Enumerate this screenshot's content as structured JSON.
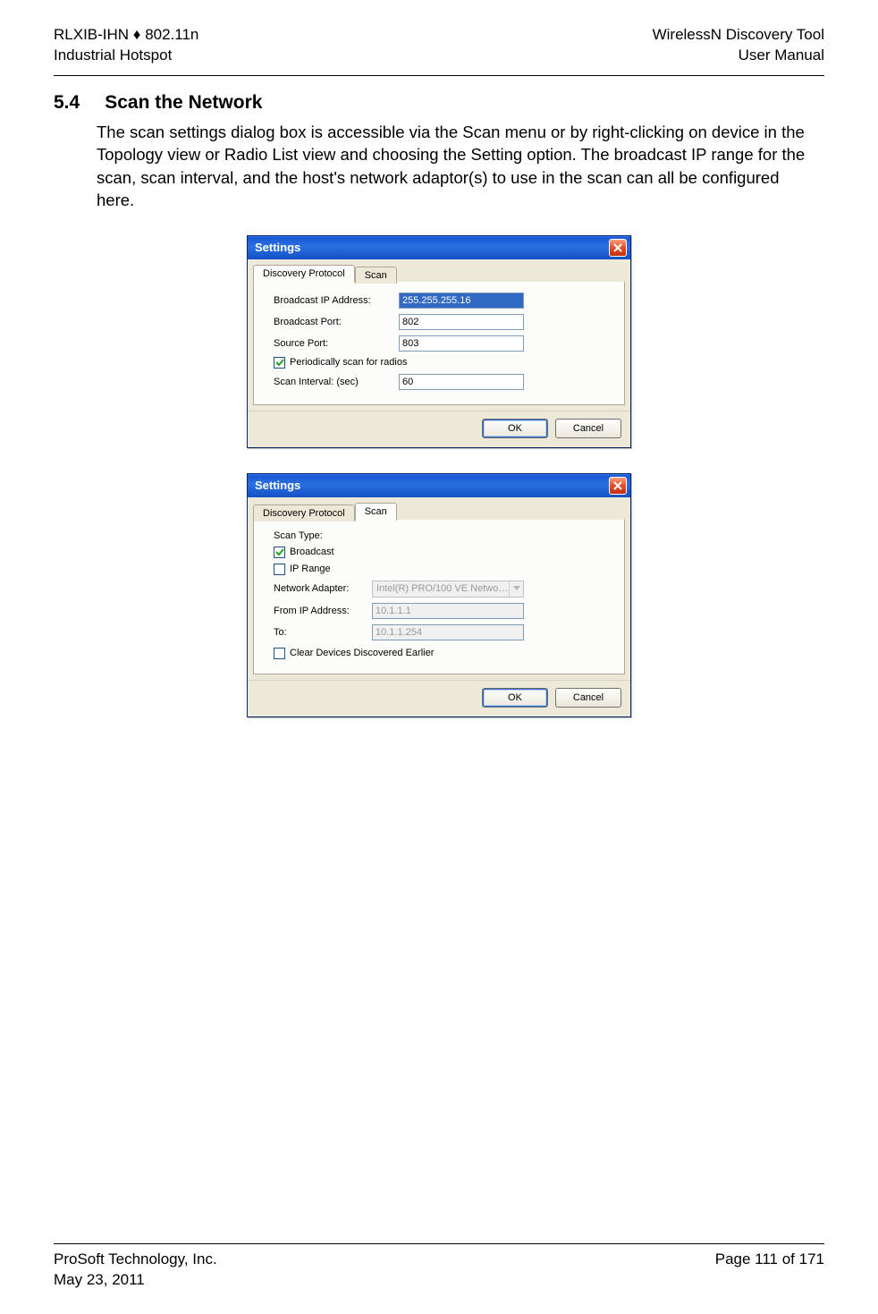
{
  "header": {
    "left_line1": "RLXIB-IHN ♦ 802.11n",
    "left_line2": "Industrial Hotspot",
    "right_line1": "WirelessN Discovery Tool",
    "right_line2": "User Manual"
  },
  "section": {
    "number": "5.4",
    "title": "Scan the Network",
    "body": "The scan settings dialog box is accessible via the Scan menu or by right-clicking on device in the Topology view or Radio List view and choosing the Setting option. The broadcast IP range for the scan, scan interval, and the host's network adaptor(s) to use in the scan can all be configured here."
  },
  "dialog1": {
    "title": "Settings",
    "tabs": {
      "discovery": "Discovery Protocol",
      "scan": "Scan"
    },
    "labels": {
      "broadcast_ip": "Broadcast IP Address:",
      "broadcast_port": "Broadcast Port:",
      "source_port": "Source Port:",
      "periodic": "Periodically scan for radios",
      "interval": "Scan Interval: (sec)"
    },
    "values": {
      "broadcast_ip": "255.255.255.16",
      "broadcast_port": "802",
      "source_port": "803",
      "interval": "60"
    },
    "buttons": {
      "ok": "OK",
      "cancel": "Cancel"
    }
  },
  "dialog2": {
    "title": "Settings",
    "tabs": {
      "discovery": "Discovery Protocol",
      "scan": "Scan"
    },
    "labels": {
      "scan_type": "Scan Type:",
      "broadcast": "Broadcast",
      "ip_range": "IP Range",
      "adapter": "Network Adapter:",
      "from_ip": "From IP Address:",
      "to": "To:",
      "clear": "Clear Devices Discovered Earlier"
    },
    "values": {
      "adapter": "Intel(R) PRO/100 VE Netwo…",
      "from_ip": "10.1.1.1",
      "to": "10.1.1.254"
    },
    "buttons": {
      "ok": "OK",
      "cancel": "Cancel"
    }
  },
  "footer": {
    "left_line1": "ProSoft Technology, Inc.",
    "left_line2": "May 23, 2011",
    "right_line1": "Page 111 of 171"
  }
}
